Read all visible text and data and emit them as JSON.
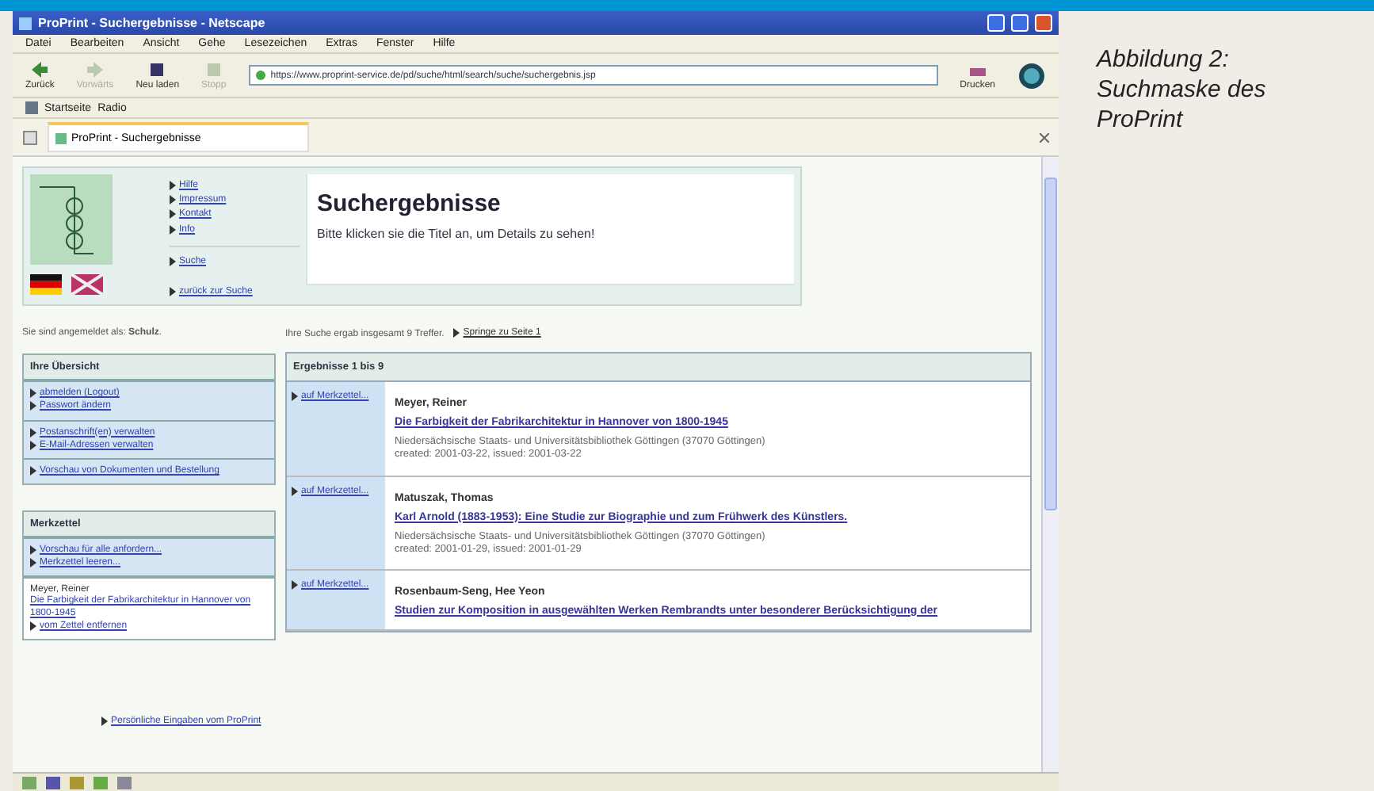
{
  "browser": {
    "title": "ProPrint - Suchergebnisse - Netscape",
    "menu": [
      "Datei",
      "Bearbeiten",
      "Ansicht",
      "Gehe",
      "Lesezeichen",
      "Extras",
      "Fenster",
      "Hilfe"
    ],
    "toolbar": [
      {
        "label": "Zurück",
        "disabled": false
      },
      {
        "label": "Vorwärts",
        "disabled": true
      },
      {
        "label": "Neu laden",
        "disabled": false
      },
      {
        "label": "Stopp",
        "disabled": true
      }
    ],
    "address": "https://www.proprint-service.de/pd/suche/html/search/suche/suchergebnis.jsp",
    "print_label": "Drucken",
    "bookmarks": [
      "Startseite",
      "Radio"
    ],
    "tab": "ProPrint - Suchergebnisse"
  },
  "page": {
    "nav_links": [
      "Hilfe",
      "Impressum",
      "Kontakt",
      "Info"
    ],
    "search_link": "Suche",
    "back_link": "zurück zur Suche",
    "heading": "Suchergebnisse",
    "subtitle": "Bitte klicken sie die Titel an, um Details zu sehen!",
    "login_note": "Sie sind angemeldet als: **Schulz**.",
    "overview": {
      "title": "Ihre Übersicht",
      "groups": [
        [
          "abmelden (Logout)",
          "Passwort ändern"
        ],
        [
          "Postanschrift(en) verwalten",
          "E-Mail-Adressen verwalten"
        ],
        [
          "Vorschau von Dokumenten und Bestellung"
        ]
      ]
    },
    "notepad": {
      "title": "Merkzettel",
      "links": [
        "Vorschau für alle anfordern...",
        "Merkzettel leeren..."
      ],
      "entry": {
        "author": "Meyer, Reiner",
        "title": "Die Farbigkeit der Fabrikarchitektur in Hannover von 1800-1945",
        "remove": "vom Zettel entfernen"
      }
    },
    "footer_link": "Persönliche Eingaben vom ProPrint",
    "results": {
      "summary": "Ihre Suche ergab insgesamt 9 Treffer.",
      "page_link": "Springe zu Seite 1",
      "header": "Ergebnisse 1 bis 9",
      "items": [
        {
          "notepad_link": "auf Merkzettel...",
          "author": "Meyer, Reiner",
          "title": "Die Farbigkeit der Fabrikarchitektur in Hannover von 1800-1945",
          "library": "Niedersächsische Staats- und Universitätsbibliothek Göttingen (37070 Göttingen)",
          "dates": "created: 2001-03-22, issued: 2001-03-22"
        },
        {
          "notepad_link": "auf Merkzettel...",
          "author": "Matuszak, Thomas",
          "title": "Karl Arnold (1883-1953): Eine Studie zur Biographie und zum Frühwerk des Künstlers.",
          "library": "Niedersächsische Staats- und Universitätsbibliothek Göttingen (37070 Göttingen)",
          "dates": "created: 2001-01-29, issued: 2001-01-29"
        },
        {
          "notepad_link": "auf Merkzettel...",
          "author": "Rosenbaum-Seng, Hee Yeon",
          "title": "Studien zur Komposition in ausgewählten Werken Rembrandts unter besonderer Berücksichtigung der"
        }
      ]
    }
  },
  "caption": "Abbildung 2: Suchmaske des ProPrint"
}
